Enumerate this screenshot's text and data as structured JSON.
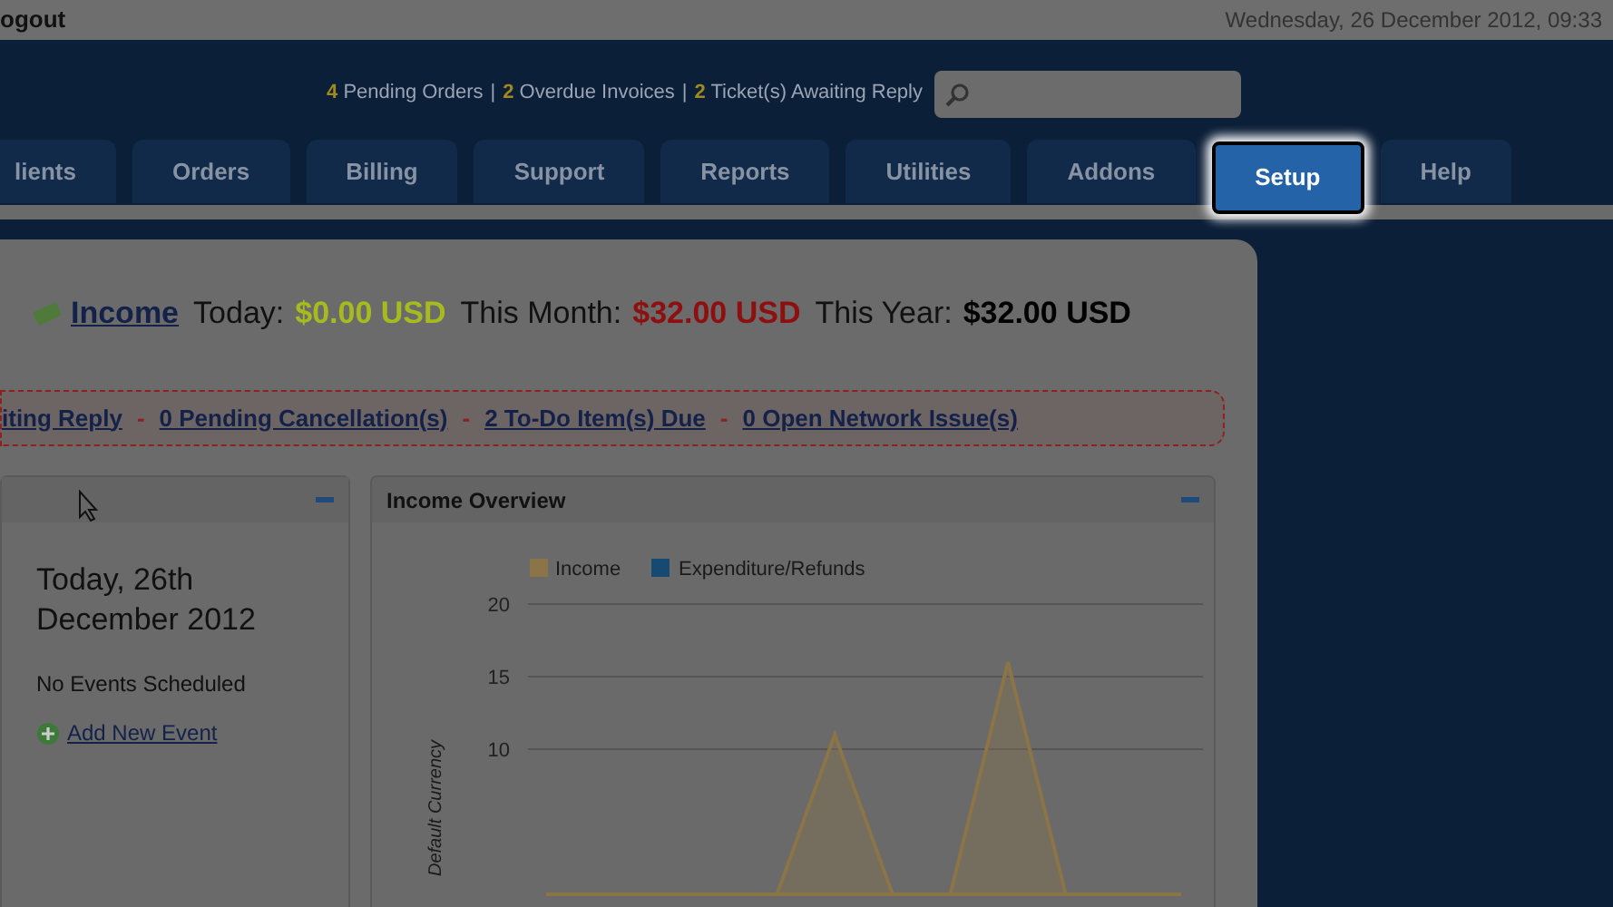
{
  "top_bar": {
    "logout_link": "ogout",
    "datetime": "Wednesday, 26 December 2012, 09:33"
  },
  "alerts": [
    {
      "count": "4",
      "label": "Pending Orders"
    },
    {
      "separator": "|",
      "count": "2",
      "label": "Overdue Invoices"
    },
    {
      "separator": "|",
      "count": "2",
      "label": "Ticket(s) Awaiting Reply"
    }
  ],
  "tabs": [
    {
      "label": "lients",
      "selected": false
    },
    {
      "label": "Orders",
      "selected": false
    },
    {
      "label": "Billing",
      "selected": false
    },
    {
      "label": "Support",
      "selected": false
    },
    {
      "label": "Reports",
      "selected": false
    },
    {
      "label": "Utilities",
      "selected": false
    },
    {
      "label": "Addons",
      "selected": false
    },
    {
      "label": "Setup",
      "selected": true
    },
    {
      "label": "Help",
      "selected": false
    }
  ],
  "income": {
    "link": "Income",
    "items": [
      {
        "label": "Today:",
        "value": "$0.00 USD",
        "color": "#a6bb1e"
      },
      {
        "label": "This Month:",
        "value": "$32.00 USD",
        "color": "#8e0f0f"
      },
      {
        "label": "This Year:",
        "value": "$32.00 USD",
        "color": "#000000"
      }
    ]
  },
  "status_links": [
    {
      "text": "iting Reply"
    },
    {
      "separator": "-",
      "text": "0 Pending Cancellation(s)"
    },
    {
      "separator": "-",
      "text": "2 To-Do Item(s) Due"
    },
    {
      "separator": "-",
      "text": "0 Open Network Issue(s)"
    }
  ],
  "calendar_widget": {
    "date": "Today, 26th December 2012",
    "message": "No Events Scheduled",
    "add_link": "Add New Event"
  },
  "income_widget": {
    "title": "Income Overview",
    "chart_data": {
      "type": "area",
      "ylabel": "Default Currency",
      "ylim": [
        0,
        20
      ],
      "yticks": [
        10,
        15,
        20
      ],
      "series": [
        {
          "name": "Income",
          "color": "#8a7448",
          "values": [
            0,
            0,
            0,
            0,
            0,
            11,
            0,
            0,
            16,
            0,
            0,
            0
          ]
        },
        {
          "name": "Expenditure/Refunds",
          "color": "#174a72",
          "values": [
            null,
            null,
            null,
            null,
            null,
            null,
            null,
            null,
            null,
            null,
            null,
            null
          ]
        }
      ]
    }
  }
}
